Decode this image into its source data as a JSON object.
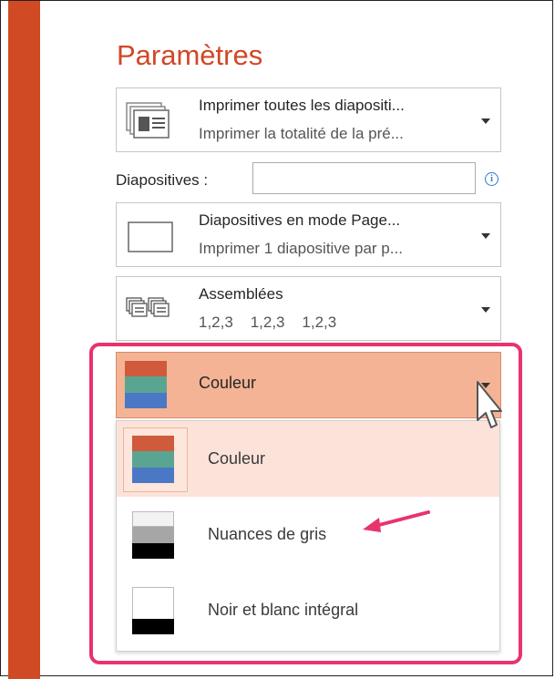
{
  "settings": {
    "title": "Paramètres",
    "print_what": {
      "main": "Imprimer toutes les diapositi...",
      "sub": "Imprimer la totalité de la pré..."
    },
    "slides_label": "Diapositives :",
    "slides_value": "",
    "layout": {
      "main": "Diapositives en mode Page...",
      "sub": "Imprimer 1 diapositive par p..."
    },
    "collate": {
      "main": "Assemblées",
      "sub": "1,2,3    1,2,3    1,2,3"
    },
    "color_mode": {
      "selected": "Couleur",
      "options": [
        "Couleur",
        "Nuances de gris",
        "Noir et blanc intégral"
      ]
    }
  },
  "colors": {
    "accent": "#d24726",
    "highlight_box": "#e8336d",
    "dropdown_selected_bg": "#f4b394",
    "menu_selected_bg": "#fbe3d9",
    "swatch_red": "#cf5a3c",
    "swatch_green": "#5aa591",
    "swatch_blue": "#4a78c5"
  },
  "icons": [
    "print-all-slides-icon",
    "full-page-slide-icon",
    "collated-icon",
    "color-swatch-icon",
    "grayscale-swatch-icon",
    "black-white-swatch-icon",
    "info-icon",
    "dropdown-caret-icon",
    "mouse-pointer-icon",
    "annotation-arrow-icon"
  ]
}
